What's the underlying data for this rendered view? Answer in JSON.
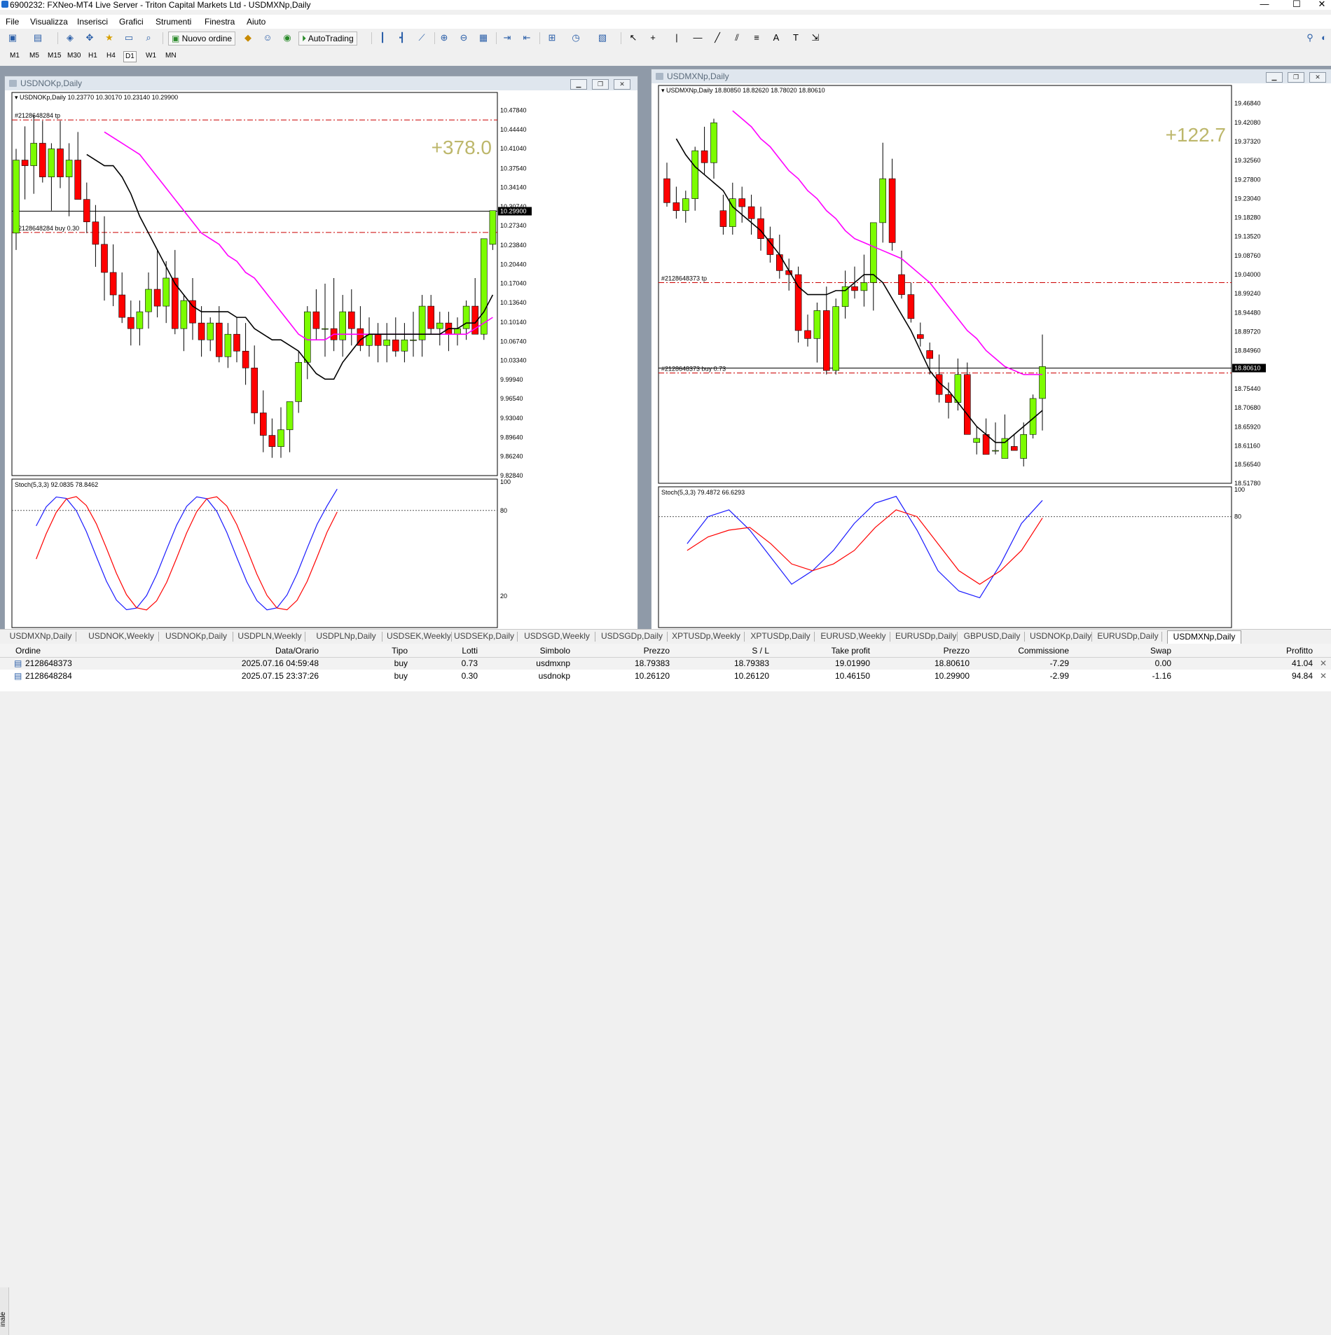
{
  "window": {
    "title": "6900232: FXNeo-MT4 Live Server - Triton Capital Markets Ltd - USDMXNp,Daily"
  },
  "menu": [
    "File",
    "Visualizza",
    "Inserisci",
    "Grafici",
    "Strumenti",
    "Finestra",
    "Aiuto"
  ],
  "toolbar": {
    "new_order": "Nuovo ordine",
    "autotrading": "AutoTrading"
  },
  "periods": [
    "M1",
    "M5",
    "M15",
    "M30",
    "H1",
    "H4",
    "D1",
    "W1",
    "MN"
  ],
  "active_period": "D1",
  "charts": {
    "left": {
      "window_title": "USDNOKp,Daily",
      "header": "USDNOKp,Daily  10.23770 10.30170 10.23140 10.29900",
      "profit": "+378.0",
      "tp_label": "#2128648284 tp",
      "buy_label": "#2128648284 buy 0.30",
      "price_tag": "10.29900",
      "ticks": [
        "10.47840",
        "10.44440",
        "10.41040",
        "10.37540",
        "10.34140",
        "10.30740",
        "10.27340",
        "10.23840",
        "10.20440",
        "10.17040",
        "10.13640",
        "10.10140",
        "10.06740",
        "10.03340",
        "9.99940",
        "9.96540",
        "9.93040",
        "9.89640",
        "9.86240",
        "9.82840"
      ],
      "stoch_label": "Stoch(5,3,3) 92.0835 78.8462",
      "stoch_ticks": [
        "100",
        "80",
        "20"
      ],
      "tp_price": 10.4615,
      "entry_price": 10.2612,
      "current_price": 10.299,
      "ylim": [
        9.8284,
        10.4954
      ]
    },
    "right": {
      "window_title": "USDMXNp,Daily",
      "header": "USDMXNp,Daily  18.80850 18.82620 18.78020 18.80610",
      "profit": "+122.7",
      "tp_label": "#2128648373 tp",
      "buy_label": "#2128648373 buy 0.73",
      "price_tag": "18.80610",
      "ticks": [
        "19.46840",
        "19.42080",
        "19.37320",
        "19.32560",
        "19.27800",
        "19.23040",
        "19.18280",
        "19.13520",
        "19.08760",
        "19.04000",
        "18.99240",
        "18.94480",
        "18.89720",
        "18.84960",
        "18.80610",
        "18.75440",
        "18.70680",
        "18.65920",
        "18.61160",
        "18.56540",
        "18.51780"
      ],
      "stoch_label": "Stoch(5,3,3) 79.4872 66.6293",
      "stoch_ticks": [
        "100",
        "80"
      ],
      "tp_price": 19.0199,
      "entry_price": 18.79383,
      "current_price": 18.8061,
      "ylim": [
        18.5178,
        19.4923
      ]
    }
  },
  "tabs": [
    "USDMXNp,Daily",
    "USDNOK,Weekly",
    "USDNOKp,Daily",
    "USDPLN,Weekly",
    "USDPLNp,Daily",
    "USDSEK,Weekly",
    "USDSEKp,Daily",
    "USDSGD,Weekly",
    "USDSGDp,Daily",
    "XPTUSDp,Weekly",
    "XPTUSDp,Daily",
    "EURUSD,Weekly",
    "EURUSDp,Daily",
    "GBPUSD,Daily",
    "USDNOKp,Daily",
    "EURUSDp,Daily",
    "USDMXNp,Daily"
  ],
  "active_tab": 16,
  "terminal": {
    "side_label": "inale",
    "columns": [
      "Ordine",
      "Data/Orario",
      "Tipo",
      "Lotti",
      "Simbolo",
      "Prezzo",
      "S / L",
      "Take profit",
      "Prezzo",
      "Commissione",
      "Swap",
      "Profitto"
    ],
    "rows": [
      [
        "2128648373",
        "2025.07.16 04:59:48",
        "buy",
        "0.73",
        "usdmxnp",
        "18.79383",
        "18.79383",
        "19.01990",
        "18.80610",
        "-7.29",
        "0.00",
        "41.04"
      ],
      [
        "2128648284",
        "2025.07.15 23:37:26",
        "buy",
        "0.30",
        "usdnokp",
        "10.26120",
        "10.26120",
        "10.46150",
        "10.29900",
        "-2.99",
        "-1.16",
        "94.84"
      ]
    ]
  },
  "colors": {
    "bull": "#7cfc00",
    "bear": "#ff0000",
    "ma_fast": "#000000",
    "ma_slow": "#ff00ff",
    "stoch_main": "#1a1aff",
    "stoch_signal": "#ff0000",
    "profit": "#bdb76b",
    "level": "#cc0000"
  },
  "chart_data": [
    {
      "type": "candlestick",
      "symbol": "USDNOKp",
      "timeframe": "Daily",
      "ylim": [
        9.8284,
        10.4954
      ],
      "candles": [
        [
          10.26,
          10.41,
          10.23,
          10.39
        ],
        [
          10.39,
          10.45,
          10.32,
          10.38
        ],
        [
          10.38,
          10.47,
          10.33,
          10.42
        ],
        [
          10.42,
          10.46,
          10.35,
          10.36
        ],
        [
          10.36,
          10.42,
          10.3,
          10.41
        ],
        [
          10.41,
          10.46,
          10.34,
          10.36
        ],
        [
          10.36,
          10.42,
          10.29,
          10.39
        ],
        [
          10.39,
          10.44,
          10.33,
          10.32
        ],
        [
          10.32,
          10.35,
          10.26,
          10.28
        ],
        [
          10.28,
          10.31,
          10.2,
          10.24
        ],
        [
          10.24,
          10.29,
          10.14,
          10.19
        ],
        [
          10.19,
          10.24,
          10.13,
          10.15
        ],
        [
          10.15,
          10.19,
          10.1,
          10.11
        ],
        [
          10.11,
          10.14,
          10.06,
          10.09
        ],
        [
          10.09,
          10.14,
          10.06,
          10.12
        ],
        [
          10.12,
          10.19,
          10.09,
          10.16
        ],
        [
          10.16,
          10.23,
          10.11,
          10.13
        ],
        [
          10.13,
          10.21,
          10.1,
          10.18
        ],
        [
          10.18,
          10.23,
          10.08,
          10.09
        ],
        [
          10.09,
          10.15,
          10.05,
          10.14
        ],
        [
          10.14,
          10.18,
          10.07,
          10.1
        ],
        [
          10.1,
          10.13,
          10.04,
          10.07
        ],
        [
          10.07,
          10.11,
          10.05,
          10.1
        ],
        [
          10.1,
          10.13,
          10.03,
          10.04
        ],
        [
          10.04,
          10.1,
          10.02,
          10.08
        ],
        [
          10.08,
          10.11,
          10.03,
          10.05
        ],
        [
          10.05,
          10.1,
          9.99,
          10.02
        ],
        [
          10.02,
          10.06,
          9.92,
          9.94
        ],
        [
          9.94,
          9.98,
          9.87,
          9.9
        ],
        [
          9.9,
          9.93,
          9.86,
          9.88
        ],
        [
          9.88,
          9.95,
          9.86,
          9.91
        ],
        [
          9.91,
          9.96,
          9.87,
          9.96
        ],
        [
          9.96,
          10.05,
          9.94,
          10.03
        ],
        [
          10.03,
          10.13,
          10.0,
          10.12
        ],
        [
          10.12,
          10.16,
          10.07,
          10.09
        ],
        [
          10.09,
          10.17,
          10.04,
          10.09
        ],
        [
          10.09,
          10.18,
          10.05,
          10.07
        ],
        [
          10.07,
          10.15,
          10.04,
          10.12
        ],
        [
          10.12,
          10.16,
          10.06,
          10.09
        ],
        [
          10.09,
          10.13,
          10.05,
          10.06
        ],
        [
          10.06,
          10.11,
          10.04,
          10.08
        ],
        [
          10.08,
          10.1,
          10.03,
          10.06
        ],
        [
          10.06,
          10.1,
          10.03,
          10.07
        ],
        [
          10.07,
          10.11,
          10.04,
          10.05
        ],
        [
          10.05,
          10.1,
          10.03,
          10.07
        ],
        [
          10.07,
          10.12,
          10.04,
          10.07
        ],
        [
          10.07,
          10.15,
          10.04,
          10.13
        ],
        [
          10.13,
          10.15,
          10.08,
          10.09
        ],
        [
          10.09,
          10.12,
          10.06,
          10.1
        ],
        [
          10.1,
          10.12,
          10.05,
          10.08
        ],
        [
          10.08,
          10.11,
          10.06,
          10.09
        ],
        [
          10.09,
          10.14,
          10.07,
          10.13
        ],
        [
          10.13,
          10.18,
          10.08,
          10.08
        ],
        [
          10.08,
          10.19,
          10.07,
          10.25
        ],
        [
          10.24,
          10.3,
          10.23,
          10.3
        ]
      ],
      "ma_fast": [
        10.4,
        10.39,
        10.38,
        10.38,
        10.36,
        10.33,
        10.29,
        10.26,
        10.23,
        10.2,
        10.17,
        10.15,
        10.13,
        10.12,
        10.12,
        10.12,
        10.12,
        10.11,
        10.11,
        10.09,
        10.08,
        10.07,
        10.07,
        10.06,
        10.05,
        10.03,
        10.01,
        10.0,
        10.0,
        10.03,
        10.05,
        10.07,
        10.08,
        10.08,
        10.08,
        10.08,
        10.08,
        10.08,
        10.08,
        10.08,
        10.08,
        10.09,
        10.09,
        10.1,
        10.1,
        10.12,
        10.15
      ],
      "ma_slow": [
        10.44,
        10.43,
        10.42,
        10.41,
        10.4,
        10.38,
        10.36,
        10.34,
        10.32,
        10.3,
        10.28,
        10.26,
        10.25,
        10.24,
        10.22,
        10.21,
        10.19,
        10.18,
        10.16,
        10.14,
        10.12,
        10.1,
        10.08,
        10.07,
        10.07,
        10.07,
        10.08,
        10.08,
        10.08,
        10.08,
        10.08,
        10.08,
        10.08,
        10.08,
        10.08,
        10.08,
        10.08,
        10.08,
        10.08,
        10.08,
        10.08,
        10.08,
        10.09,
        10.1,
        10.11
      ]
    },
    {
      "type": "candlestick",
      "symbol": "USDMXNp",
      "timeframe": "Daily",
      "ylim": [
        18.5178,
        19.4923
      ],
      "candles": [
        [
          19.28,
          19.32,
          19.21,
          19.22
        ],
        [
          19.22,
          19.26,
          19.18,
          19.2
        ],
        [
          19.2,
          19.25,
          19.17,
          19.23
        ],
        [
          19.23,
          19.36,
          19.2,
          19.35
        ],
        [
          19.35,
          19.41,
          19.29,
          19.32
        ],
        [
          19.32,
          19.43,
          19.28,
          19.42
        ],
        [
          19.2,
          19.24,
          19.14,
          19.16
        ],
        [
          19.16,
          19.27,
          19.14,
          19.23
        ],
        [
          19.23,
          19.26,
          19.17,
          19.21
        ],
        [
          19.21,
          19.24,
          19.14,
          19.18
        ],
        [
          19.18,
          19.21,
          19.1,
          19.13
        ],
        [
          19.13,
          19.16,
          19.07,
          19.09
        ],
        [
          19.09,
          19.14,
          19.03,
          19.05
        ],
        [
          19.05,
          19.08,
          19.0,
          19.04
        ],
        [
          19.04,
          19.06,
          18.87,
          18.9
        ],
        [
          18.9,
          18.94,
          18.86,
          18.88
        ],
        [
          18.88,
          18.97,
          18.82,
          18.95
        ],
        [
          18.95,
          19.01,
          18.79,
          18.8
        ],
        [
          18.8,
          18.98,
          18.79,
          18.96
        ],
        [
          18.96,
          19.05,
          18.93,
          19.01
        ],
        [
          19.01,
          19.06,
          18.98,
          19.0
        ],
        [
          19.0,
          19.09,
          18.96,
          19.02
        ],
        [
          19.02,
          19.09,
          18.95,
          19.17
        ],
        [
          19.17,
          19.37,
          19.12,
          19.28
        ],
        [
          19.28,
          19.33,
          19.1,
          19.12
        ],
        [
          19.04,
          19.1,
          18.98,
          18.99
        ],
        [
          18.99,
          19.02,
          18.92,
          18.93
        ],
        [
          18.89,
          18.92,
          18.86,
          18.88
        ],
        [
          18.85,
          18.87,
          18.79,
          18.83
        ],
        [
          18.79,
          18.84,
          18.72,
          18.74
        ],
        [
          18.74,
          18.77,
          18.68,
          18.72
        ],
        [
          18.72,
          18.83,
          18.7,
          18.79
        ],
        [
          18.79,
          18.82,
          18.64,
          18.64
        ],
        [
          18.62,
          18.66,
          18.59,
          18.63
        ],
        [
          18.64,
          18.68,
          18.6,
          18.59
        ],
        [
          18.6,
          18.67,
          18.59,
          18.6
        ],
        [
          18.58,
          18.69,
          18.58,
          18.63
        ],
        [
          18.61,
          18.64,
          18.6,
          18.6
        ],
        [
          18.58,
          18.67,
          18.56,
          18.64
        ],
        [
          18.64,
          18.74,
          18.63,
          18.73
        ],
        [
          18.73,
          18.89,
          18.65,
          18.81
        ]
      ],
      "ma_fast": [
        19.38,
        19.34,
        19.31,
        19.29,
        19.27,
        19.25,
        19.21,
        19.19,
        19.17,
        19.15,
        19.12,
        19.09,
        19.05,
        19.01,
        18.99,
        18.99,
        18.99,
        19.0,
        19.0,
        19.02,
        19.04,
        19.04,
        19.02,
        18.98,
        18.94,
        18.9,
        18.85,
        18.8,
        18.77,
        18.75,
        18.72,
        18.69,
        18.66,
        18.64,
        18.62,
        18.62,
        18.64,
        18.66,
        18.68,
        18.7
      ],
      "ma_slow": [
        19.45,
        19.43,
        19.41,
        19.38,
        19.36,
        19.33,
        19.3,
        19.28,
        19.25,
        19.23,
        19.2,
        19.18,
        19.15,
        19.13,
        19.12,
        19.11,
        19.1,
        19.09,
        19.08,
        19.06,
        19.04,
        19.02,
        18.99,
        18.96,
        18.93,
        18.9,
        18.88,
        18.85,
        18.83,
        18.81,
        18.8,
        18.79,
        18.79,
        18.79
      ],
      "stoch": {
        "main": [
          60,
          80,
          85,
          70,
          50,
          30,
          40,
          55,
          75,
          90,
          95,
          70,
          40,
          25,
          20,
          45,
          75,
          92
        ],
        "signal": [
          55,
          65,
          70,
          72,
          60,
          45,
          40,
          45,
          55,
          72,
          85,
          80,
          60,
          40,
          30,
          40,
          55,
          79
        ]
      }
    }
  ]
}
